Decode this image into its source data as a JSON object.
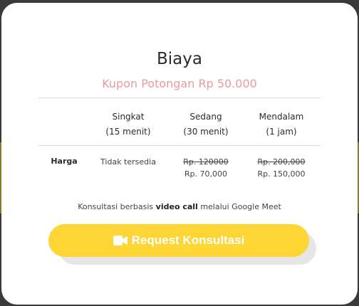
{
  "modal": {
    "title": "Biaya",
    "subtitle": "Kupon Potongan Rp 50.000"
  },
  "table": {
    "columns": [
      {
        "name": "Singkat",
        "duration": "(15 menit)"
      },
      {
        "name": "Sedang",
        "duration": "(30 menit)"
      },
      {
        "name": "Mendalam",
        "duration": "(1 jam)"
      }
    ],
    "row_label": "Harga",
    "prices": [
      {
        "text": "Tidak tersedia"
      },
      {
        "original": "Rp. 120000",
        "discounted": "Rp. 70,000"
      },
      {
        "original": "Rp. 200,000",
        "discounted": "Rp. 150,000"
      }
    ]
  },
  "note": {
    "prefix": "Konsultasi berbasis ",
    "bold": "video call",
    "suffix": " melalui Google Meet"
  },
  "button": {
    "label": "Request Konsultasi",
    "icon": "video-camera-icon",
    "color": "#fdd535"
  },
  "colors": {
    "subtitle": "#ea9a9f"
  }
}
